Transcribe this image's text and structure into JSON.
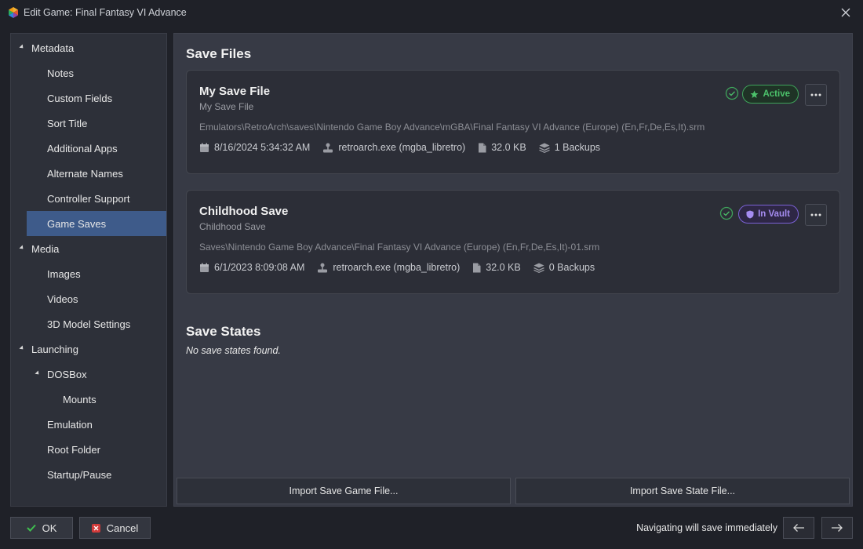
{
  "window": {
    "title": "Edit Game: Final Fantasy VI Advance"
  },
  "sidebar": {
    "items": [
      {
        "label": "Metadata"
      },
      {
        "label": "Notes"
      },
      {
        "label": "Custom Fields"
      },
      {
        "label": "Sort Title"
      },
      {
        "label": "Additional Apps"
      },
      {
        "label": "Alternate Names"
      },
      {
        "label": "Controller Support"
      },
      {
        "label": "Game Saves"
      },
      {
        "label": "Media"
      },
      {
        "label": "Images"
      },
      {
        "label": "Videos"
      },
      {
        "label": "3D Model Settings"
      },
      {
        "label": "Launching"
      },
      {
        "label": "DOSBox"
      },
      {
        "label": "Mounts"
      },
      {
        "label": "Emulation"
      },
      {
        "label": "Root Folder"
      },
      {
        "label": "Startup/Pause"
      }
    ],
    "selected": "Game Saves"
  },
  "main": {
    "save_files_title": "Save Files",
    "saves": [
      {
        "title": "My Save File",
        "subtitle": "My Save File",
        "path": "Emulators\\RetroArch\\saves\\Nintendo Game Boy Advance\\mGBA\\Final Fantasy VI Advance (Europe) (En,Fr,De,Es,It).srm",
        "date": "8/16/2024 5:34:32 AM",
        "emulator": "retroarch.exe (mgba_libretro)",
        "size": "32.0 KB",
        "backups": "1 Backups",
        "badge": "Active",
        "badge_color": "#4cc26b"
      },
      {
        "title": "Childhood Save",
        "subtitle": "Childhood Save",
        "path": "Saves\\Nintendo Game Boy Advance\\Final Fantasy VI Advance (Europe) (En,Fr,De,Es,It)-01.srm",
        "date": "6/1/2023 8:09:08 AM",
        "emulator": "retroarch.exe (mgba_libretro)",
        "size": "32.0 KB",
        "backups": "0 Backups",
        "badge": "In Vault",
        "badge_color": "#a58cf0"
      }
    ],
    "save_states_title": "Save States",
    "save_states_empty": "No save states found.",
    "import_save_label": "Import Save Game File...",
    "import_state_label": "Import Save State File..."
  },
  "footer": {
    "ok_label": "OK",
    "cancel_label": "Cancel",
    "nav_note": "Navigating will save immediately"
  },
  "colors": {
    "accent_selected": "#3e5b8a",
    "ok_check": "#3fbf4f",
    "cancel_x": "#d23b3b"
  }
}
